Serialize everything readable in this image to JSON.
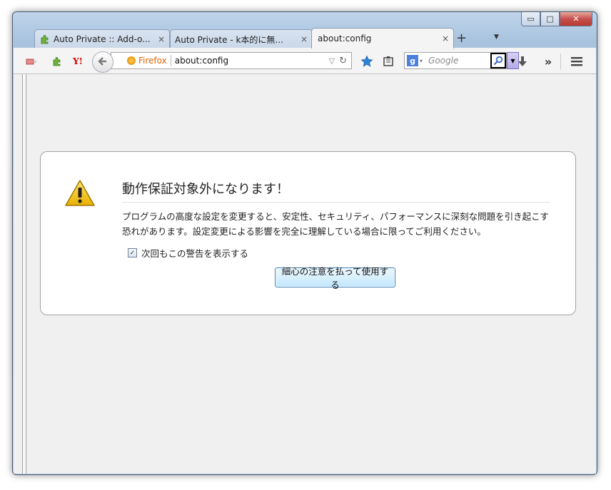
{
  "window": {
    "min_glyph": "▭",
    "max_glyph": "□",
    "close_glyph": "✕"
  },
  "tabs": [
    {
      "label": "Auto Private :: Add-o...",
      "close": "×"
    },
    {
      "label": "Auto Private - k本的に無...",
      "close": "×"
    },
    {
      "label": "about:config",
      "close": "×"
    }
  ],
  "tabbar": {
    "new_tab": "+",
    "list_all": "▼"
  },
  "navbar": {
    "identity_label": "Firefox",
    "url": "about:config",
    "search_engine_icon": "g",
    "search_placeholder": "Google",
    "overflow": "»"
  },
  "warning": {
    "title": "動作保証対象外になります！",
    "message": "プログラムの高度な設定を変更すると、安定性、セキュリティ、パフォーマンスに深刻な問題を引き起こす恐れがあります。設定変更による影響を完全に理解している場合に限ってご利用ください。",
    "checkbox_label": "次回もこの警告を表示する",
    "checkbox_checked": true,
    "accept_button": "細心の注意を払って使用する"
  }
}
